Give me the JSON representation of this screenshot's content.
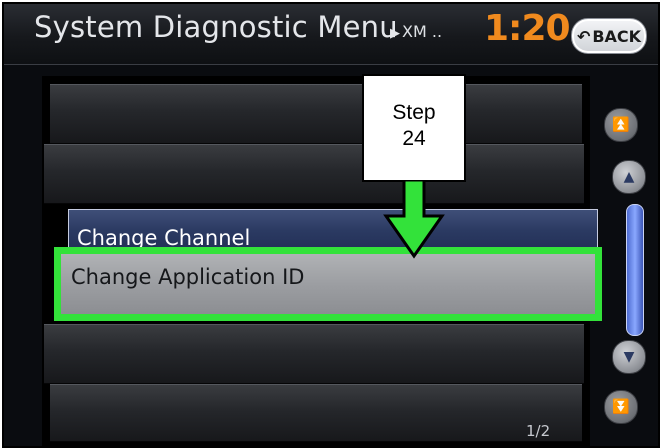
{
  "header": {
    "title": "System Diagnostic Menu",
    "breadcrumb": "XM ..",
    "clock": "1:20",
    "back_label": "BACK",
    "back_icon": "back-arrow-icon"
  },
  "menu": {
    "items": [
      {
        "label": "",
        "state": "normal"
      },
      {
        "label": "",
        "state": "normal"
      },
      {
        "label": "Change Channel",
        "state": "selected"
      },
      {
        "label": "Change Application ID",
        "state": "highlighted"
      },
      {
        "label": "",
        "state": "normal"
      },
      {
        "label": "",
        "state": "normal"
      }
    ],
    "page_indicator": "1/2"
  },
  "scroll": {
    "buttons": [
      "double-up-icon",
      "up-icon",
      "down-icon",
      "double-down-icon"
    ]
  },
  "callout": {
    "line1": "Step",
    "line2": "24"
  },
  "colors": {
    "accent_orange": "#f08a1e",
    "highlight_green": "#33e23a",
    "selection_blue": "#2b3a62"
  }
}
